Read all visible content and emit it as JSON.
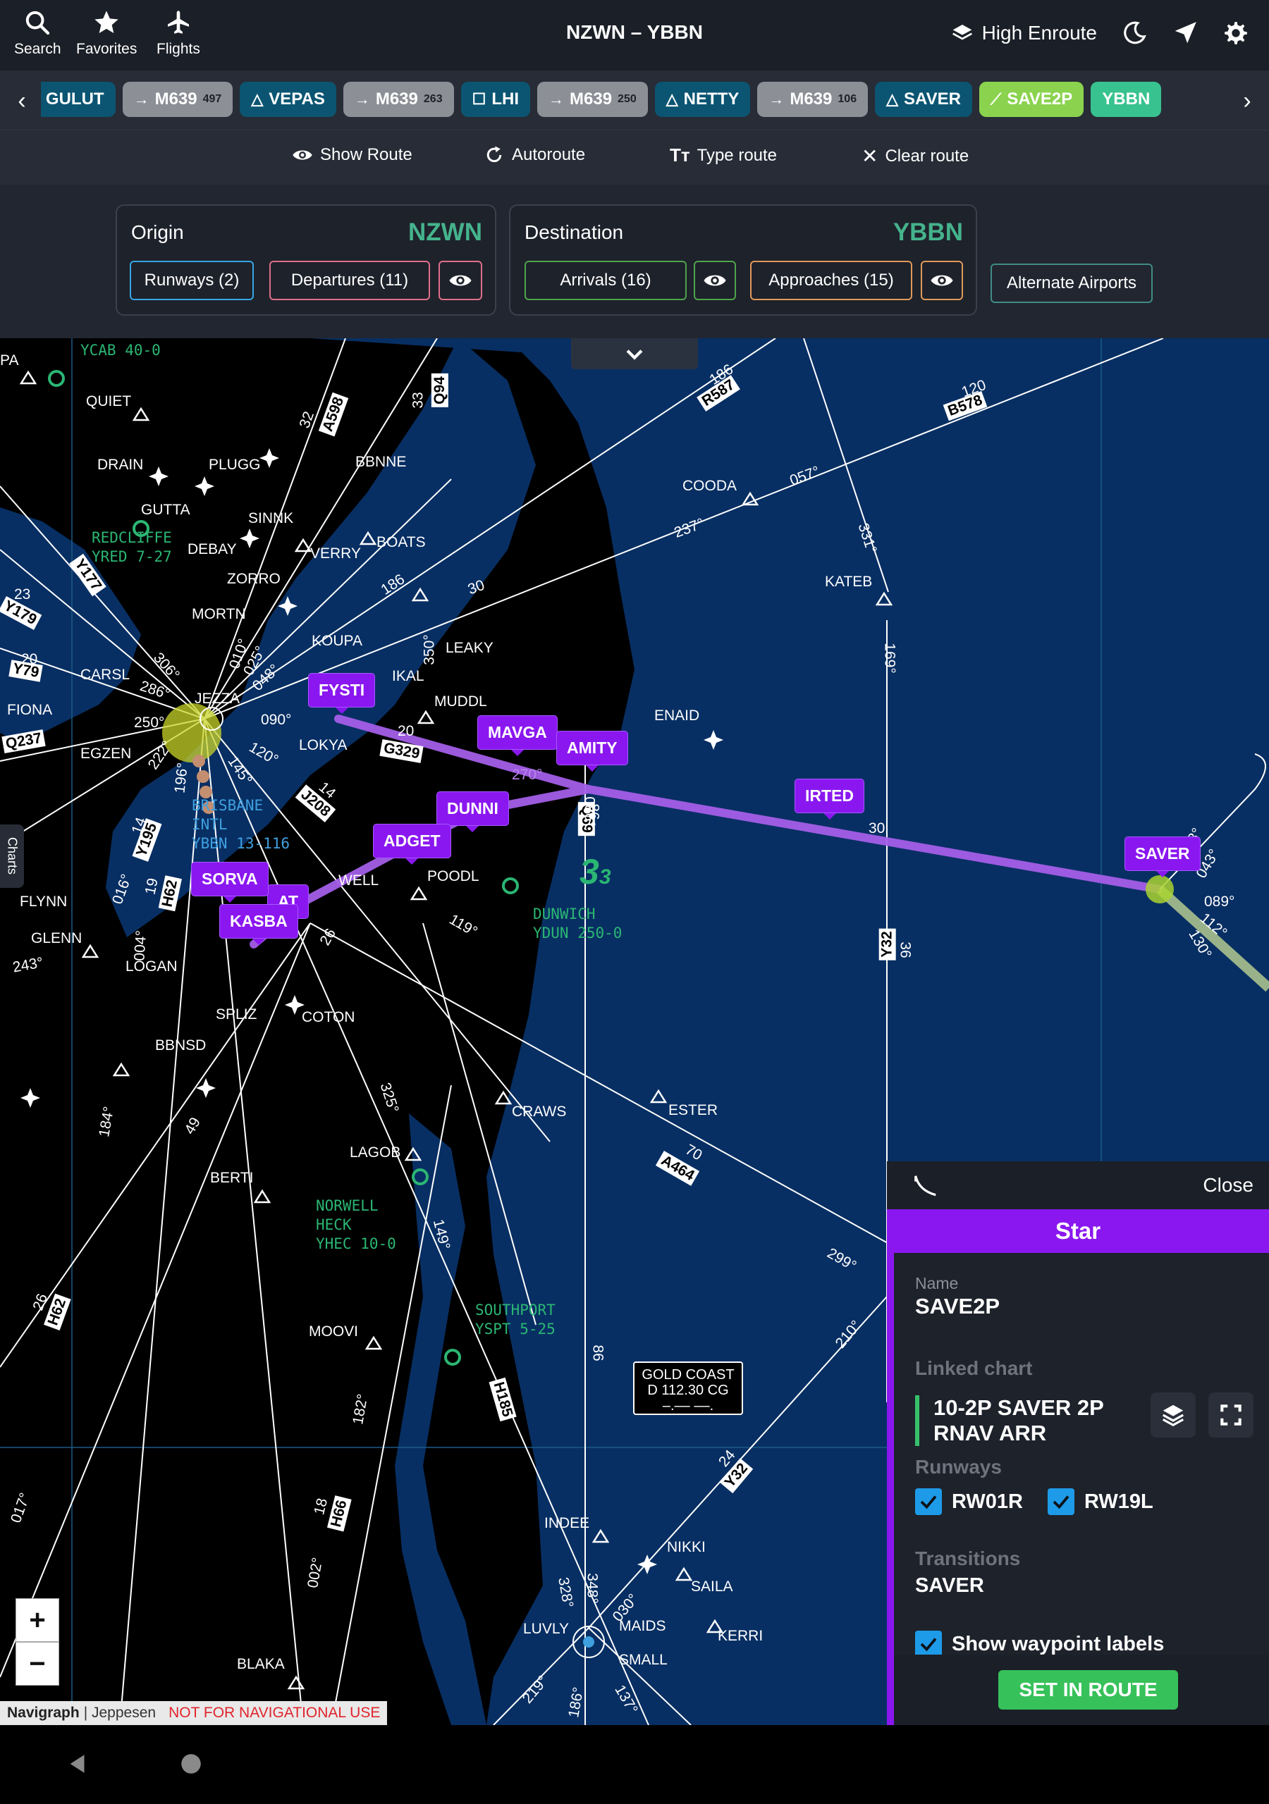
{
  "topbar": {
    "title": "NZWN – YBBN",
    "nav": [
      {
        "label": "Search",
        "icon": "search-icon"
      },
      {
        "label": "Favorites",
        "icon": "star-icon"
      },
      {
        "label": "Flights",
        "icon": "airplane-icon"
      }
    ],
    "layer_label": "High Enroute",
    "icons": [
      "layers-icon",
      "night-mode-icon",
      "location-arrow-icon",
      "gear-icon"
    ]
  },
  "route_strip": {
    "items": [
      {
        "type": "waypoint",
        "label": "GULUT"
      },
      {
        "type": "airway",
        "label": "M639",
        "alt": "497"
      },
      {
        "type": "waypoint",
        "label": "VEPAS"
      },
      {
        "type": "airway",
        "label": "M639",
        "alt": "263"
      },
      {
        "type": "navaid",
        "label": "LHI"
      },
      {
        "type": "airway",
        "label": "M639",
        "alt": "250"
      },
      {
        "type": "waypoint",
        "label": "NETTY"
      },
      {
        "type": "airway",
        "label": "M639",
        "alt": "106"
      },
      {
        "type": "waypoint",
        "label": "SAVER"
      },
      {
        "type": "star",
        "label": "SAVE2P"
      },
      {
        "type": "destination",
        "label": "YBBN"
      }
    ],
    "colors": {
      "waypoint": "#0b5572",
      "airway": "#8c8f96",
      "star": "#8bd34f",
      "destination": "#38c28f"
    }
  },
  "actions": {
    "show_route": "Show Route",
    "autoroute": "Autoroute",
    "type_route": "Type route",
    "clear_route": "Clear route"
  },
  "origin": {
    "title": "Origin",
    "code": "NZWN",
    "runways": "Runways (2)",
    "departures": "Departures (11)"
  },
  "destination": {
    "title": "Destination",
    "code": "YBBN",
    "arrivals": "Arrivals (16)",
    "approaches": "Approaches (15)"
  },
  "alternate_airports": "Alternate Airports",
  "map": {
    "charts_tab": "Charts",
    "zoom_in": "+",
    "zoom_out": "−",
    "attribution": {
      "brand": "Navigraph",
      "provider": "| Jeppesen",
      "warning": "NOT FOR NAVIGATIONAL USE"
    },
    "vor_box": {
      "line1": "GOLD COAST",
      "line2": "D 112.30 CG",
      "line3": "–.–– ––."
    },
    "route_tags": [
      "FYSTI",
      "MAVGA",
      "AMITY",
      "IRTED",
      "SAVER",
      "DUNNI",
      "ADGET",
      "SORVA",
      "KASBA",
      "AT"
    ],
    "fix_labels": [
      "QUIET",
      "DRAIN",
      "PLUGG",
      "GUTTA",
      "SINNK",
      "DEBAY",
      "VERRY",
      "BOATS",
      "BBNNE",
      "ZORRO",
      "MORTN",
      "KOUPA",
      "LEAKY",
      "COODA",
      "KATEB",
      "CARSL",
      "FIONA",
      "JEZZA",
      "EGZEN",
      "LOKYA",
      "MUDDL",
      "ENAID",
      "IKAL",
      "POODL",
      "WELL",
      "FLYNN",
      "GLENN",
      "LOGAN",
      "SPLIZ",
      "COTON",
      "BBNSD",
      "CRAWS",
      "ESTER",
      "LAGOB",
      "BERTI",
      "MOOVI",
      "INDEE",
      "NIKKI",
      "SAILA",
      "KERRI",
      "MAIDS",
      "LUVLY",
      "SMALL",
      "BLAKA",
      "PA"
    ],
    "airway_labels": [
      "A598",
      "Q94",
      "R587",
      "B578",
      "Y177",
      "Y179",
      "Y79",
      "Q237",
      "G329",
      "J208",
      "Y195",
      "H62",
      "Q69",
      "Y32",
      "H185",
      "A464",
      "H66",
      "Y32",
      "H62"
    ],
    "airport_labels": [
      {
        "lines": [
          "YCAB 40-0"
        ],
        "color": "green"
      },
      {
        "lines": [
          "REDCLIFFE",
          "YRED 7-27"
        ],
        "color": "green"
      },
      {
        "lines": [
          "BRISBANE",
          "INTL",
          "YBBN 13-116"
        ],
        "color": "blue"
      },
      {
        "lines": [
          "DUNWICH",
          "YDUN 250-0"
        ],
        "color": "green"
      },
      {
        "lines": [
          "NORWELL",
          "HECK",
          "YHEC 10-0"
        ],
        "color": "green"
      },
      {
        "lines": [
          "SOUTHPORT",
          "YSPT 5-25"
        ],
        "color": "green"
      }
    ],
    "bearing_labels": [
      "057°",
      "237°",
      "331°",
      "169°",
      "090°",
      "270°",
      "306°",
      "286°",
      "250°",
      "010°",
      "025°",
      "048°",
      "120°",
      "145°",
      "196°",
      "222°",
      "350°",
      "086°",
      "119°",
      "016°",
      "004°",
      "243°",
      "184°",
      "325°",
      "149°",
      "182°",
      "210°",
      "299°",
      "017°",
      "002°",
      "328°",
      "348°",
      "030°",
      "219°",
      "186°",
      "137°",
      "023°",
      "043°",
      "089°",
      "112°",
      "130°"
    ],
    "alt_labels": [
      "186",
      "120",
      "32",
      "33",
      "20",
      "23",
      "186",
      "30",
      "20",
      "14",
      "14",
      "19",
      "36",
      "26",
      "49",
      "70",
      "24",
      "18",
      "26",
      "86",
      "86",
      "30"
    ]
  },
  "star_panel": {
    "close": "Close",
    "heading": "Star",
    "name_label": "Name",
    "name": "SAVE2P",
    "linked_chart_label": "Linked chart",
    "linked_chart": "10-2P SAVER 2P RNAV ARR",
    "runways_label": "Runways",
    "runways": [
      {
        "label": "RW01R",
        "checked": true
      },
      {
        "label": "RW19L",
        "checked": true
      }
    ],
    "transitions_label": "Transitions",
    "transition": "SAVER",
    "show_labels": "Show waypoint labels",
    "set_button": "SET IN ROUTE",
    "accent": "#8a17f0"
  }
}
